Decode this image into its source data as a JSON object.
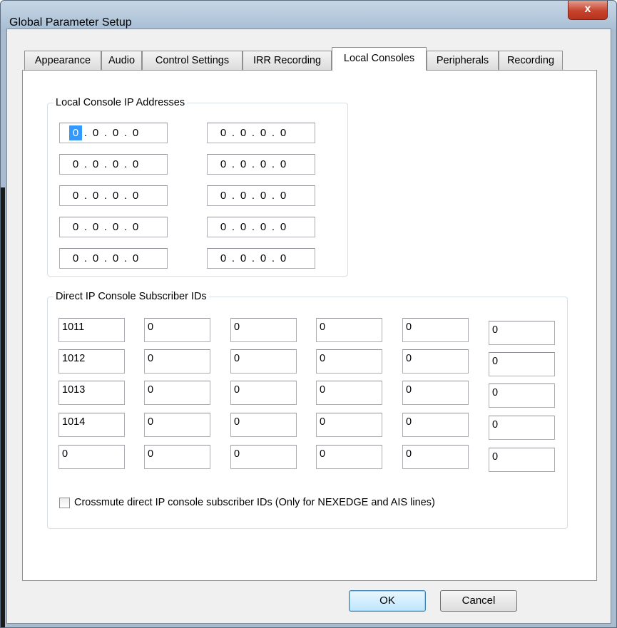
{
  "window": {
    "title": "Global Parameter Setup",
    "close_label": "x"
  },
  "tabs": [
    {
      "label": "Appearance",
      "active": false
    },
    {
      "label": "Audio",
      "active": false
    },
    {
      "label": "Control Settings",
      "active": false
    },
    {
      "label": "IRR Recording",
      "active": false
    },
    {
      "label": "Local Consoles",
      "active": true
    },
    {
      "label": "Peripherals",
      "active": false
    },
    {
      "label": "Recording",
      "active": false
    }
  ],
  "local_console_ips": {
    "group_label": "Local Console IP Addresses",
    "left": [
      [
        "0",
        "0",
        "0",
        "0"
      ],
      [
        "0",
        "0",
        "0",
        "0"
      ],
      [
        "0",
        "0",
        "0",
        "0"
      ],
      [
        "0",
        "0",
        "0",
        "0"
      ],
      [
        "0",
        "0",
        "0",
        "0"
      ]
    ],
    "right": [
      [
        "0",
        "0",
        "0",
        "0"
      ],
      [
        "0",
        "0",
        "0",
        "0"
      ],
      [
        "0",
        "0",
        "0",
        "0"
      ],
      [
        "0",
        "0",
        "0",
        "0"
      ],
      [
        "0",
        "0",
        "0",
        "0"
      ]
    ]
  },
  "subscriber_ids": {
    "group_label": "Direct IP Console Subscriber IDs",
    "rows": [
      [
        "1011",
        "0",
        "0",
        "0",
        "0",
        "0"
      ],
      [
        "1012",
        "0",
        "0",
        "0",
        "0",
        "0"
      ],
      [
        "1013",
        "0",
        "0",
        "0",
        "0",
        "0"
      ],
      [
        "1014",
        "0",
        "0",
        "0",
        "0",
        "0"
      ],
      [
        "0",
        "0",
        "0",
        "0",
        "0",
        "0"
      ]
    ]
  },
  "crossmute": {
    "label": "Crossmute direct IP console subscriber IDs (Only for NEXEDGE and AIS lines)",
    "checked": false
  },
  "buttons": {
    "ok_label": "OK",
    "cancel_label": "Cancel"
  }
}
